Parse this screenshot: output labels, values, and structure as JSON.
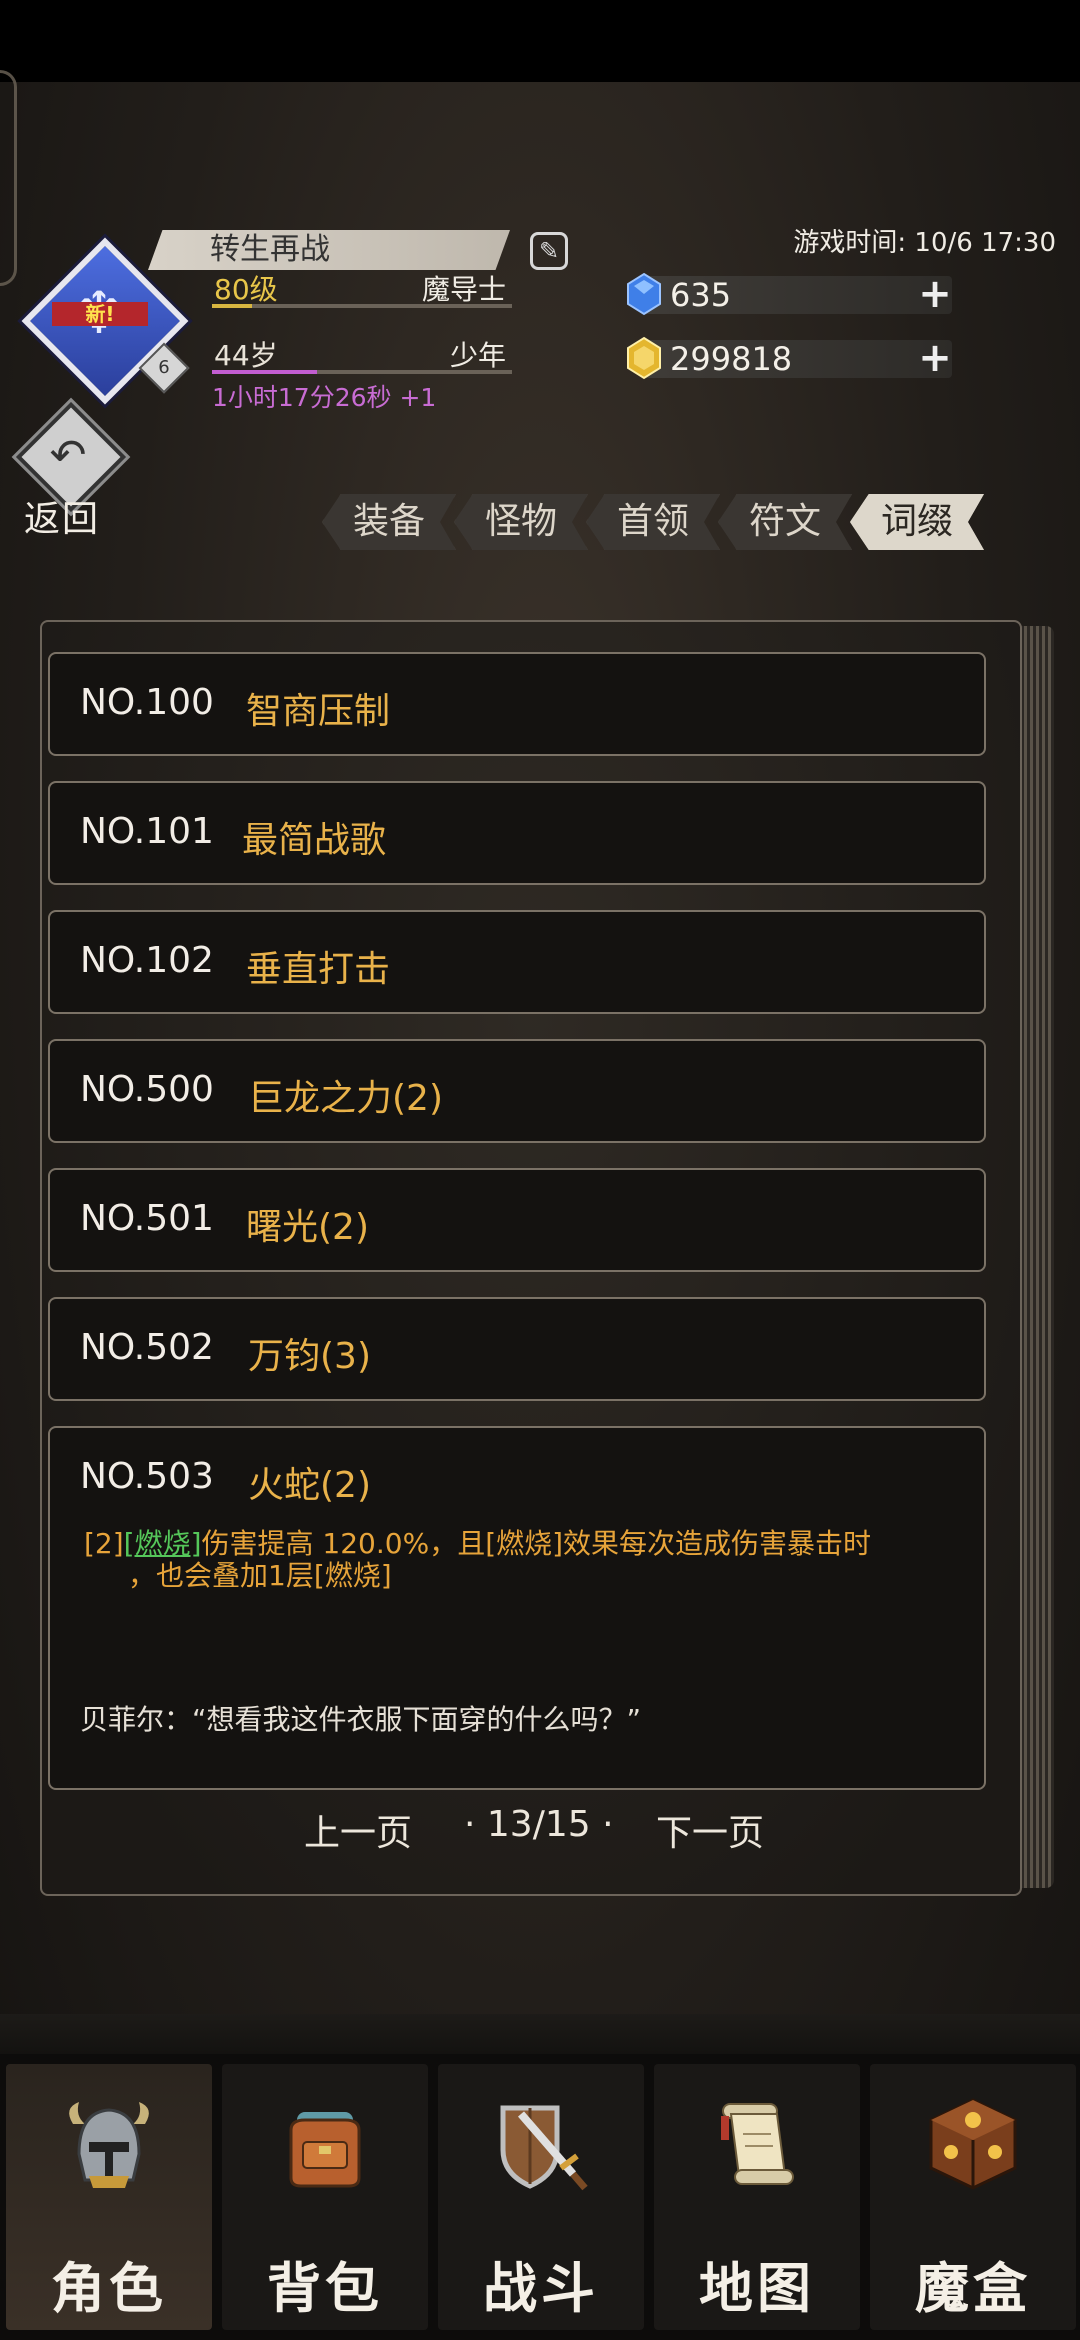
{
  "player": {
    "name": "转生再战",
    "level": "80级",
    "class": "魔导士",
    "age": "44岁",
    "age_stage": "少年",
    "play_time": "1小时17分26秒 +1",
    "avatar_badge": "新!",
    "rank": "6"
  },
  "game_time": "游戏时间: 10/6 17:30",
  "currency": {
    "gems": "635",
    "gold": "299818"
  },
  "back_label": "返回",
  "tabs": [
    {
      "label": "装备"
    },
    {
      "label": "怪物"
    },
    {
      "label": "首领"
    },
    {
      "label": "符文"
    },
    {
      "label": "词缀",
      "active": true
    }
  ],
  "entries": [
    {
      "no": "NO.100",
      "name": "智商压制"
    },
    {
      "no": "NO.101",
      "name": "最简战歌"
    },
    {
      "no": "NO.102",
      "name": "垂直打击"
    },
    {
      "no": "NO.500",
      "name": "巨龙之力(2)"
    },
    {
      "no": "NO.501",
      "name": "曙光(2)"
    },
    {
      "no": "NO.502",
      "name": "万钧(3)"
    },
    {
      "no": "NO.503",
      "name": "火蛇(2)",
      "desc_prefix": "[2]",
      "desc_keyword": "[燃烧]",
      "desc_line1": "伤害提高 120.0%，且[燃烧]效果每次造成伤害暴击时",
      "desc_line2": "，也会叠加1层[燃烧]",
      "quote": "贝菲尔：“想看我这件衣服下面穿的什么吗？”"
    }
  ],
  "pager": {
    "prev": "上一页",
    "page": "· 13/15 ·",
    "next": "下一页"
  },
  "nav": [
    {
      "label": "角色",
      "icon": "helmet-icon",
      "active": true
    },
    {
      "label": "背包",
      "icon": "backpack-icon"
    },
    {
      "label": "战斗",
      "icon": "sword-shield-icon"
    },
    {
      "label": "地图",
      "icon": "scroll-map-icon"
    },
    {
      "label": "魔盒",
      "icon": "magic-box-icon"
    }
  ],
  "colors": {
    "accent_gold": "#e9b24a",
    "burn_green": "#55c75a",
    "time_purple": "#c86cd3"
  }
}
